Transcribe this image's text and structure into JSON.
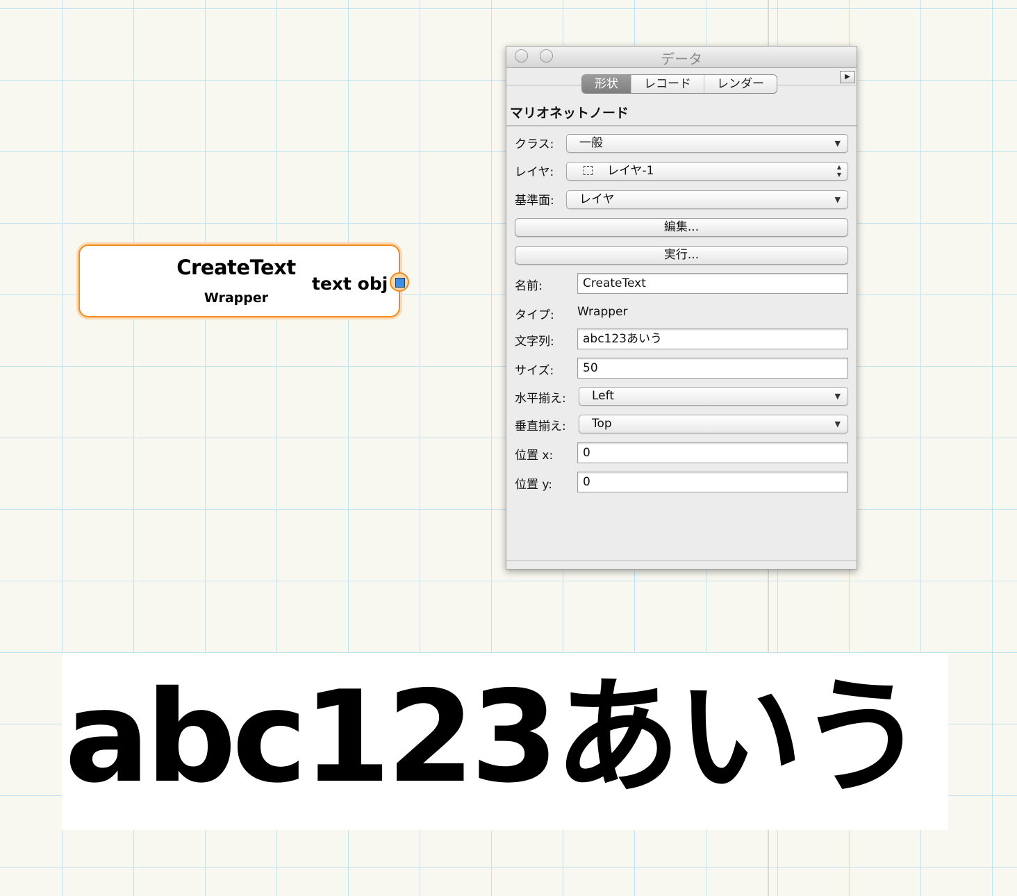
{
  "node": {
    "title": "CreateText",
    "type": "Wrapper",
    "output_port_label": "text obj"
  },
  "output_text": "abc123あいう",
  "palette": {
    "window_title": "データ",
    "collapse_glyph": "▶",
    "tabs": [
      "形状",
      "レコード",
      "レンダー"
    ],
    "active_tab": "形状",
    "section_title": "マリオネットノード",
    "class": {
      "label": "クラス:",
      "value": "一般"
    },
    "layer": {
      "label": "レイヤ:",
      "value": "レイヤ-1"
    },
    "plane": {
      "label": "基準面:",
      "value": "レイヤ"
    },
    "edit_button": "編集...",
    "run_button": "実行...",
    "name": {
      "label": "名前:",
      "value": "CreateText"
    },
    "type": {
      "label": "タイプ:",
      "value": "Wrapper"
    },
    "string": {
      "label": "文字列:",
      "value": "abc123あいう"
    },
    "size": {
      "label": "サイズ:",
      "value": "50"
    },
    "h_align": {
      "label": "水平揃え:",
      "value": "Left"
    },
    "v_align": {
      "label": "垂直揃え:",
      "value": "Top"
    },
    "pos_x": {
      "label": "位置 x:",
      "value": "0"
    },
    "pos_y": {
      "label": "位置 y:",
      "value": "0"
    }
  },
  "colors": {
    "canvas_bg": "#f8f8f0",
    "grid_line": "#c6e1ee",
    "node_border": "#f28a1e",
    "port_fill": "#3f8de0",
    "active_tab": "#8e8e8e"
  },
  "icons": {
    "dropdown": "chevron-down-icon",
    "stepper": "up-down-stepper-icon",
    "layer": "layer-icon",
    "collapse": "triangle-right-icon"
  }
}
